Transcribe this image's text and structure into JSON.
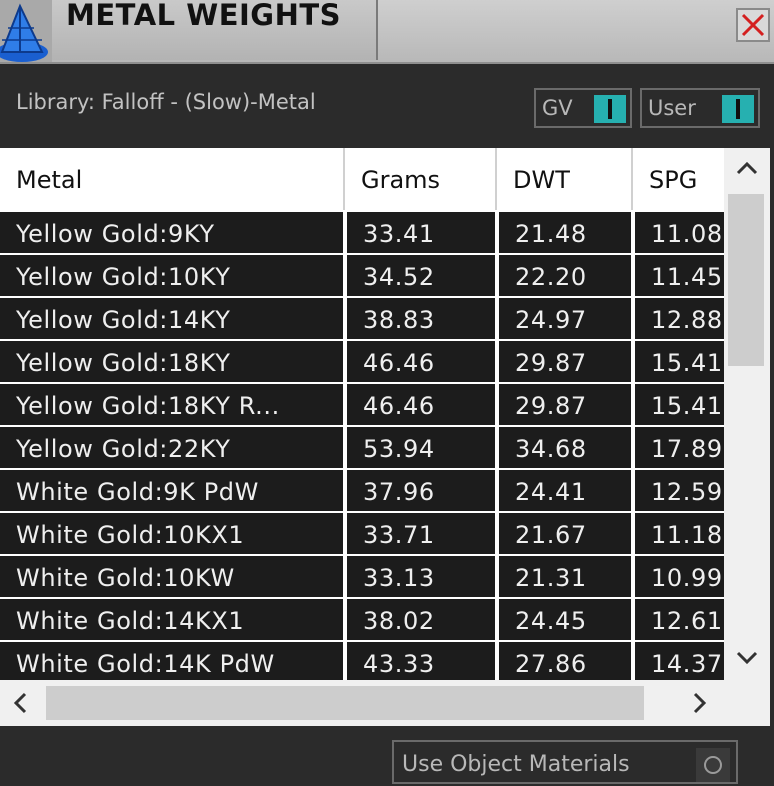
{
  "window": {
    "title": "METAL WEIGHTS",
    "close_icon": "close-x-icon",
    "app_icon": "blue-pyramid-icon"
  },
  "library": {
    "label": "Library: Falloff - (Slow)-Metal"
  },
  "toggles": {
    "gv_label": "GV",
    "user_label": "User",
    "accent_color": "#26b0b0"
  },
  "table": {
    "headers": [
      "Metal",
      "Grams",
      "DWT",
      "SPG"
    ],
    "rows": [
      [
        "Yellow Gold:9KY",
        "33.41",
        "21.48",
        "11.08"
      ],
      [
        "Yellow Gold:10KY",
        "34.52",
        "22.20",
        "11.45"
      ],
      [
        "Yellow Gold:14KY",
        "38.83",
        "24.97",
        "12.88"
      ],
      [
        "Yellow Gold:18KY",
        "46.46",
        "29.87",
        "15.41"
      ],
      [
        "Yellow Gold:18KY R...",
        "46.46",
        "29.87",
        "15.41"
      ],
      [
        "Yellow Gold:22KY",
        "53.94",
        "34.68",
        "17.89"
      ],
      [
        "White Gold:9K PdW",
        "37.96",
        "24.41",
        "12.59"
      ],
      [
        "White Gold:10KX1",
        "33.71",
        "21.67",
        "11.18"
      ],
      [
        "White Gold:10KW",
        "33.13",
        "21.31",
        "10.99"
      ],
      [
        "White Gold:14KX1",
        "38.02",
        "24.45",
        "12.61"
      ],
      [
        "White Gold:14K PdW",
        "43.33",
        "27.86",
        "14.37"
      ]
    ]
  },
  "bottom": {
    "use_object_materials_label": "Use Object Materials"
  }
}
